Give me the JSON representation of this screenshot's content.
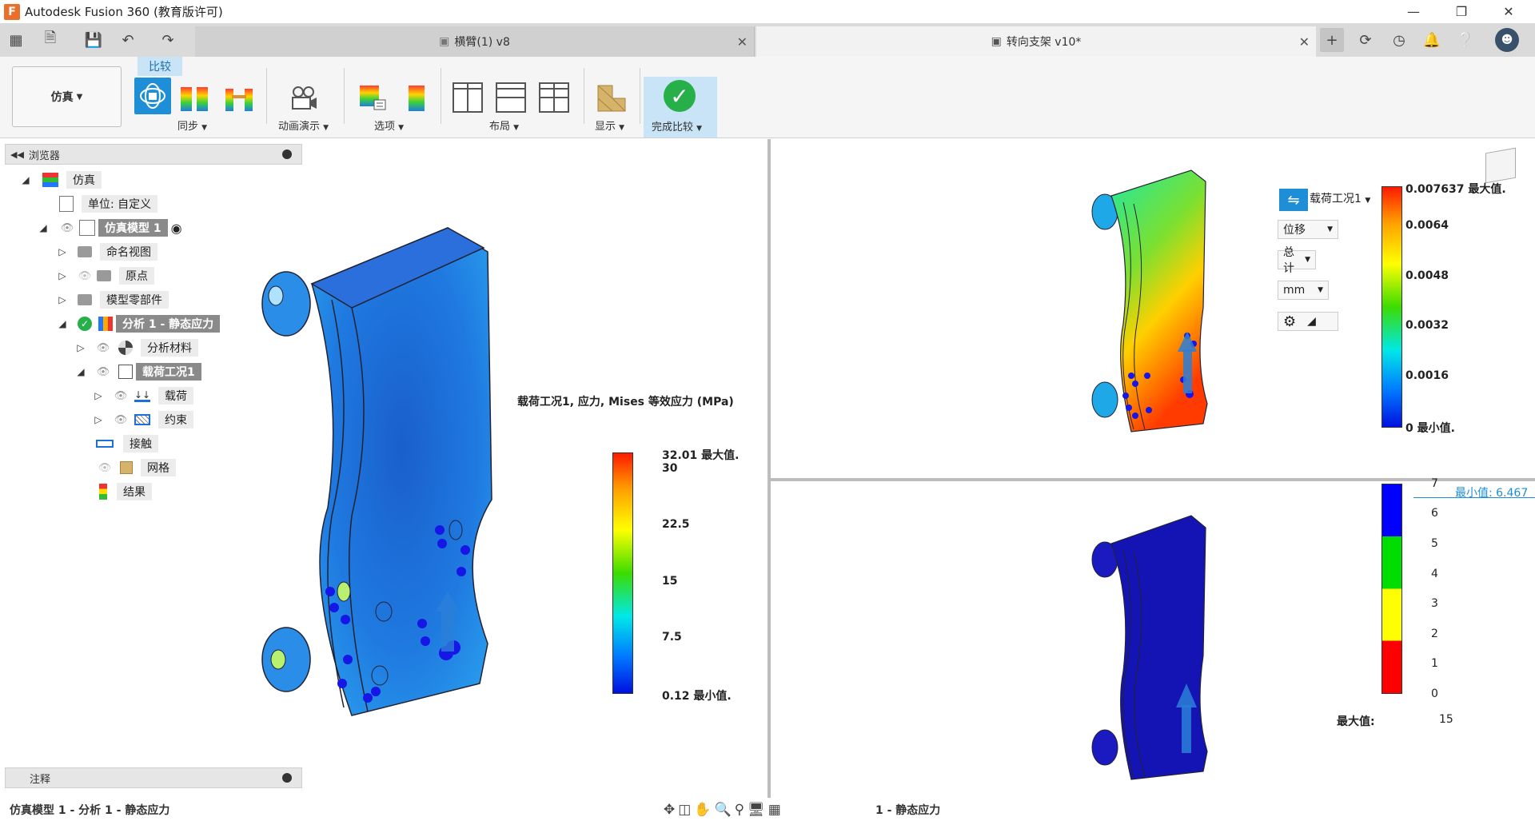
{
  "window": {
    "title": "Autodesk Fusion 360 (教育版许可)",
    "app_icon_letter": "F"
  },
  "tabs": [
    {
      "label": "横臂(1) v8",
      "active": false
    },
    {
      "label": "转向支架 v10*",
      "active": true
    }
  ],
  "ribbon": {
    "workspace_label": "仿真",
    "compare_tab": "比较",
    "groups": {
      "sync": "同步",
      "animate": "动画演示",
      "options": "选项",
      "layout": "布局",
      "display": "显示",
      "finish": "完成比较"
    }
  },
  "browser": {
    "title": "浏览器",
    "items": [
      {
        "label": "仿真"
      },
      {
        "label": "单位: 自定义"
      },
      {
        "label": "仿真模型 1"
      },
      {
        "label": "命名视图"
      },
      {
        "label": "原点"
      },
      {
        "label": "模型零部件"
      },
      {
        "label": "分析 1 - 静态应力"
      },
      {
        "label": "分析材料"
      },
      {
        "label": "载荷工况1"
      },
      {
        "label": "载荷"
      },
      {
        "label": "约束"
      },
      {
        "label": "接触"
      },
      {
        "label": "网格"
      },
      {
        "label": "结果"
      }
    ]
  },
  "notes": {
    "title": "注释"
  },
  "left_view": {
    "result_title": "载荷工况1, 应力, Mises 等效应力 (MPa)",
    "legend": {
      "max_label": "32.01 最大值.",
      "ticks": [
        "30",
        "22.5",
        "15",
        "7.5"
      ],
      "min_label": "0.12 最小值."
    }
  },
  "top_right_view": {
    "load_case": "载荷工况1",
    "result_type": "位移",
    "component": "总计",
    "unit": "mm",
    "legend": {
      "max_label": "0.007637 最大值.",
      "ticks": [
        "0.0064",
        "0.0048",
        "0.0032",
        "0.0016"
      ],
      "min_label": "0 最小值."
    }
  },
  "bottom_right_view": {
    "min_value_label": "最小值: 6.467",
    "legend_ticks": [
      "7",
      "6",
      "5",
      "4",
      "3",
      "2",
      "1",
      "0"
    ],
    "max_label": "最大值:",
    "max_value": "15"
  },
  "status": {
    "left_text": "仿真模型 1 - 分析 1 - 静态应力",
    "center_text": "1 - 静态应力"
  },
  "colors": {
    "accent": "#0696d7",
    "check_green": "#27b04a",
    "stress_part": "#1f6fd6",
    "safety_part": "#1414b4"
  }
}
